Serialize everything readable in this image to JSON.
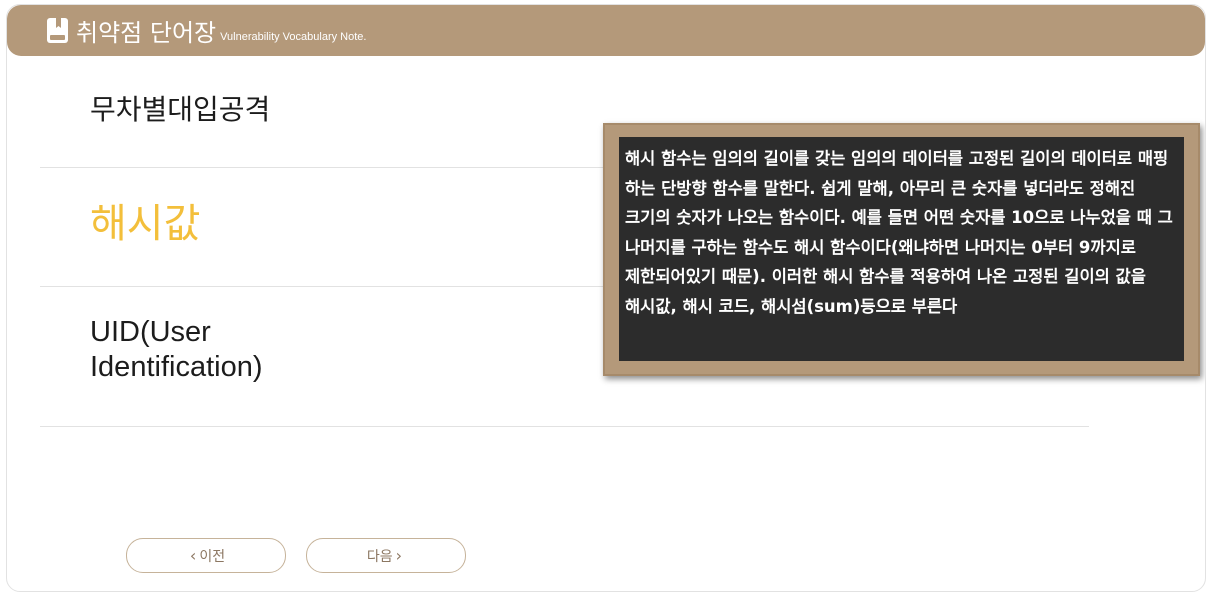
{
  "header": {
    "title_ko": "취약점 단어장",
    "title_en": "Vulnerability Vocabulary Note.",
    "icon": "book-icon"
  },
  "words": [
    {
      "label": "무차별대입공격"
    },
    {
      "label": "해시값",
      "highlight_color": "#f3bf3b"
    },
    {
      "label": "UID(User Identification)"
    }
  ],
  "tooltip": {
    "text": "해시 함수는 임의의 길이를 갖는 임의의 데이터를 고정된 길이의 데이터로 매핑 하는 단방향 함수를 말한다. 쉽게 말해, 아무리 큰 숫자를 넣더라도 정해진 크기의 숫자가 나오는 함수이다. 예를 들면 어떤 숫자를 10으로 나누었을 때 그 나머지를 구하는 함수도 해시 함수이다(왜냐하면 나머지는 0부터 9까지로 제한되어있기 때문). 이러한 해시 함수를 적용하여 나온 고정된 길이의 값을 해시값, 해시 코드, 해시섬(sum)등으로 부른다"
  },
  "nav": {
    "prev_label": "이전",
    "next_label": "다음"
  },
  "colors": {
    "accent": "#b4997a",
    "highlight": "#f3bf3b",
    "tooltip_bg": "#2c2c2c"
  }
}
